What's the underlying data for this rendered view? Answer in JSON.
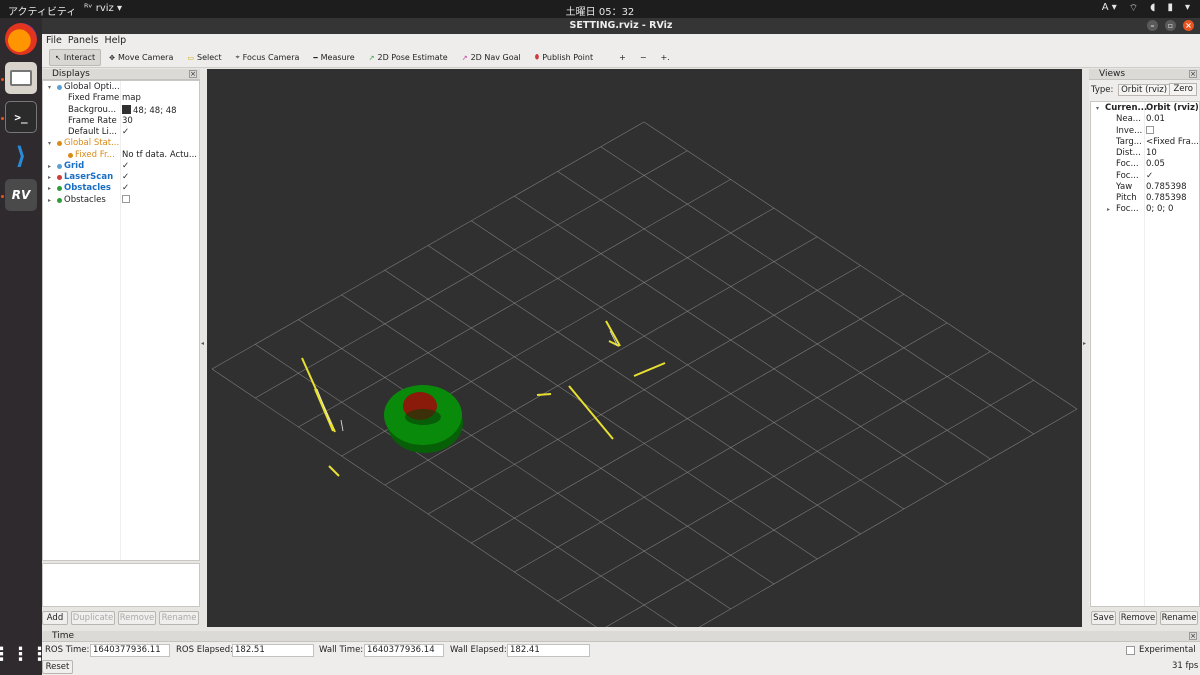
{
  "topbar": {
    "activities": "アクティビティ",
    "app_name": "rviz",
    "clock": "土曜日 05：32",
    "input_method": "A"
  },
  "window": {
    "title": "SETTING.rviz - RViz"
  },
  "menu": [
    "File",
    "Panels",
    "Help"
  ],
  "toolbar": {
    "tools": [
      {
        "label": "Interact",
        "icon": "cursor-icon",
        "active": true
      },
      {
        "label": "Move Camera",
        "icon": "move-camera-icon"
      },
      {
        "label": "Select",
        "icon": "select-icon"
      },
      {
        "label": "Focus Camera",
        "icon": "focus-icon"
      },
      {
        "label": "Measure",
        "icon": "ruler-icon"
      },
      {
        "label": "2D Pose Estimate",
        "icon": "pose-arrow-icon"
      },
      {
        "label": "2D Nav Goal",
        "icon": "goal-arrow-icon"
      },
      {
        "label": "Publish Point",
        "icon": "pin-icon"
      }
    ]
  },
  "displays": {
    "title": "Displays",
    "rows": [
      {
        "label": "Global Opti...",
        "value": "",
        "indent": 0,
        "arrow": "▾",
        "color": "#222",
        "marker": "#5aa0d8"
      },
      {
        "label": "Fixed Frame",
        "value": "map",
        "indent": 1
      },
      {
        "label": "Backgrou...",
        "value": "48; 48; 48",
        "indent": 1,
        "swatch": "#303030"
      },
      {
        "label": "Frame Rate",
        "value": "30",
        "indent": 1
      },
      {
        "label": "Default Li...",
        "value": "✓",
        "indent": 1
      },
      {
        "label": "Global Stat...",
        "value": "",
        "indent": 0,
        "arrow": "▾",
        "color": "#d98a17",
        "marker": "#d98a17"
      },
      {
        "label": "Fixed Fr...",
        "value": "No tf data.  Actu...",
        "indent": 1,
        "color": "#d98a17",
        "marker": "#d98a17"
      },
      {
        "label": "Grid",
        "value": "✓",
        "indent": 0,
        "arrow": "▸",
        "color": "#1a6fc4",
        "bold": true,
        "marker": "#5aa0d8"
      },
      {
        "label": "LaserScan",
        "value": "✓",
        "indent": 0,
        "arrow": "▸",
        "color": "#1a6fc4",
        "bold": true,
        "marker": "#d23a3a"
      },
      {
        "label": "Obstacles",
        "value": "✓",
        "indent": 0,
        "arrow": "▸",
        "color": "#1a6fc4",
        "bold": true,
        "marker": "#2e9e3a"
      },
      {
        "label": "Obstacles",
        "value": "",
        "indent": 0,
        "arrow": "▸",
        "color": "#222",
        "marker": "#2e9e3a",
        "unchecked": true
      }
    ],
    "buttons": [
      "Add",
      "Duplicate",
      "Remove",
      "Rename"
    ]
  },
  "views": {
    "title": "Views",
    "type_label": "Type:",
    "type_value": "Orbit (rviz)",
    "zero_label": "Zero",
    "rows": [
      {
        "label": "Curren...",
        "value": "Orbit (rviz)",
        "indent": 0,
        "arrow": "▾",
        "bold": true
      },
      {
        "label": "Nea...",
        "value": "0.01",
        "indent": 1
      },
      {
        "label": "Inve...",
        "value": "",
        "indent": 1,
        "box": true
      },
      {
        "label": "Targ...",
        "value": "<Fixed Fra...",
        "indent": 1
      },
      {
        "label": "Dist...",
        "value": "10",
        "indent": 1
      },
      {
        "label": "Foc...",
        "value": "0.05",
        "indent": 1
      },
      {
        "label": "Foc...",
        "value": "✓",
        "indent": 1
      },
      {
        "label": "Yaw",
        "value": "0.785398",
        "indent": 1
      },
      {
        "label": "Pitch",
        "value": "0.785398",
        "indent": 1
      },
      {
        "label": "Foc...",
        "value": "0; 0; 0",
        "indent": 1,
        "arrow": "▸"
      }
    ],
    "buttons": [
      "Save",
      "Remove",
      "Rename"
    ]
  },
  "time": {
    "title": "Time",
    "ros_time_label": "ROS Time:",
    "ros_time": "1640377936.11",
    "ros_elapsed_label": "ROS Elapsed:",
    "ros_elapsed": "182.51",
    "wall_time_label": "Wall Time:",
    "wall_time": "1640377936.14",
    "wall_elapsed_label": "Wall Elapsed:",
    "wall_elapsed": "182.41",
    "experimental_label": "Experimental",
    "reset_label": "Reset",
    "fps": "31 fps"
  },
  "colors": {
    "grid": "#9a9a9a",
    "laser": "#e8e030",
    "obstacle_ring": "#0a8a0a",
    "obstacle_core": "#8a1a0a",
    "background": "#303030"
  }
}
